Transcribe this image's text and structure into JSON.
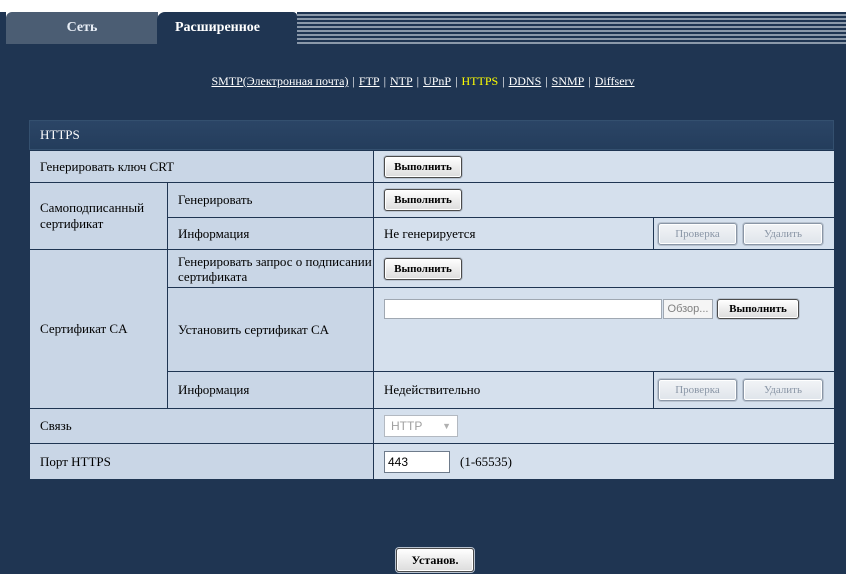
{
  "tabs": [
    {
      "label": "Сеть",
      "active": false
    },
    {
      "label": "Расширенное",
      "active": true
    }
  ],
  "subnav": [
    {
      "label": "SMTP(Электронная почта)",
      "active": false
    },
    {
      "label": "FTP",
      "active": false
    },
    {
      "label": "NTP",
      "active": false
    },
    {
      "label": "UPnP",
      "active": false
    },
    {
      "label": "HTTPS",
      "active": true
    },
    {
      "label": "DDNS",
      "active": false
    },
    {
      "label": "SNMP",
      "active": false
    },
    {
      "label": "Diffserv",
      "active": false
    }
  ],
  "section_title": "HTTPS",
  "rows": {
    "gen_crt": {
      "label": "Генерировать ключ CRT",
      "button": "Выполнить"
    },
    "self_signed": {
      "label": "Самоподписанный сертификат",
      "generate": {
        "label": "Генерировать",
        "button": "Выполнить"
      },
      "info": {
        "label": "Информация",
        "value": "Не генерируется",
        "check_button": "Проверка",
        "delete_button": "Удалить"
      }
    },
    "ca_cert": {
      "label": "Сертификат CA",
      "csr": {
        "label": "Генерировать запрос о подписании сертификата",
        "button": "Выполнить"
      },
      "install": {
        "label": "Установить сертификат CA",
        "file_value": "",
        "browse_button": "Обзор...",
        "button": "Выполнить"
      },
      "info": {
        "label": "Информация",
        "value": "Недействительно",
        "check_button": "Проверка",
        "delete_button": "Удалить"
      }
    },
    "connection": {
      "label": "Связь",
      "selected": "HTTP"
    },
    "https_port": {
      "label": "Порт HTTPS",
      "value": "443",
      "range": "(1-65535)"
    }
  },
  "submit_label": "Установ.",
  "colors": {
    "background": "#1f3552",
    "row_label": "#c9d6e6",
    "row_value": "#d5e0ed",
    "active_link": "#ffff00"
  }
}
